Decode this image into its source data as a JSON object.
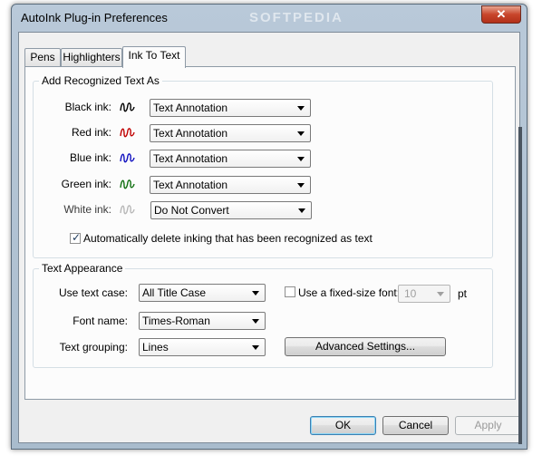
{
  "window": {
    "title": "AutoInk Plug-in Preferences",
    "watermark": "SOFTPEDIA",
    "close_glyph": "✕"
  },
  "tabs": [
    {
      "label": "Pens"
    },
    {
      "label": "Highlighters"
    },
    {
      "label": "Ink To Text",
      "active": true
    }
  ],
  "recognized": {
    "group_label": "Add Recognized Text As",
    "rows": [
      {
        "label": "Black ink:",
        "ink_color": "#000000",
        "value": "Text Annotation"
      },
      {
        "label": "Red ink:",
        "ink_color": "#c00000",
        "value": "Text Annotation"
      },
      {
        "label": "Blue ink:",
        "ink_color": "#1010c0",
        "value": "Text Annotation"
      },
      {
        "label": "Green ink:",
        "ink_color": "#107010",
        "value": "Text Annotation"
      },
      {
        "label": "White ink:",
        "ink_color": "#b8b8b8",
        "value": "Do Not Convert"
      }
    ],
    "auto_delete": {
      "label": "Automatically delete inking that has been recognized as text",
      "checked": true
    }
  },
  "appearance": {
    "group_label": "Text Appearance",
    "text_case": {
      "label": "Use text case:",
      "value": "All Title Case"
    },
    "fixed_size": {
      "label": "Use a fixed-size font:",
      "checked": false,
      "value": "10",
      "unit": "pt"
    },
    "font_name": {
      "label": "Font name:",
      "value": "Times-Roman"
    },
    "grouping": {
      "label": "Text grouping:",
      "value": "Lines"
    },
    "advanced_button": "Advanced Settings..."
  },
  "buttons": {
    "ok": "OK",
    "cancel": "Cancel",
    "apply": "Apply"
  }
}
